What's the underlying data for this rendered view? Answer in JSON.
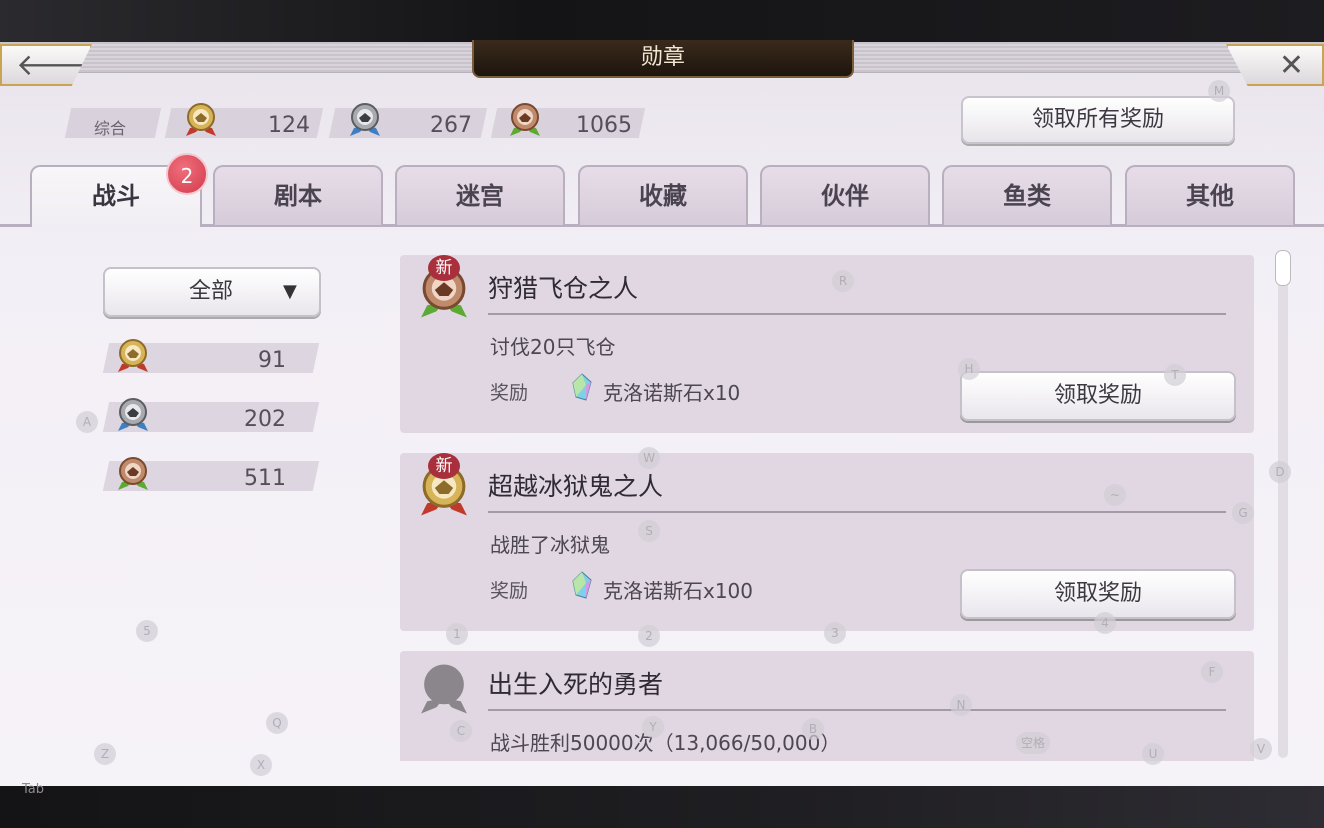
{
  "window": {
    "title": "勋章"
  },
  "nav": {
    "back_icon": "arrow-left-icon",
    "close_icon": "close-icon",
    "back_glyph": "🡐",
    "close_glyph": "✕"
  },
  "stats": {
    "label": "综合",
    "gold": "124",
    "silver": "267",
    "bronze": "1065"
  },
  "claim_all_label": "领取所有奖励",
  "tabs": [
    {
      "label": "战斗",
      "active": true
    },
    {
      "label": "剧本"
    },
    {
      "label": "迷宫"
    },
    {
      "label": "收藏"
    },
    {
      "label": "伙伴"
    },
    {
      "label": "鱼类"
    },
    {
      "label": "其他"
    }
  ],
  "tab_badge": "2",
  "filter": {
    "selected": "全部",
    "caret": "▼"
  },
  "side_counts": {
    "gold": "91",
    "silver": "202",
    "bronze": "511"
  },
  "achievements": [
    {
      "new_tag": "新",
      "title": "狩猎飞仓之人",
      "desc": "讨伐20只飞仓",
      "reward_label": "奖励",
      "reward_item": "克洛诺斯石x10",
      "claim_label": "领取奖励",
      "medal": "bronze"
    },
    {
      "new_tag": "新",
      "title": "超越冰狱鬼之人",
      "desc": "战胜了冰狱鬼",
      "reward_label": "奖励",
      "reward_item": "克洛诺斯石x100",
      "claim_label": "领取奖励",
      "medal": "gold"
    },
    {
      "title": "出生入死的勇者",
      "desc": "战斗胜利50000次（13,066/50,000）",
      "medal": "locked"
    }
  ],
  "overlay_keys": [
    "M",
    "R",
    "H",
    "T",
    "A",
    "W",
    "D",
    "G",
    "S",
    "~",
    "5",
    "1",
    "2",
    "3",
    "4",
    "F",
    "Q",
    "C",
    "Y",
    "B",
    "N",
    "空格",
    "U",
    "Z",
    "X",
    "V"
  ],
  "tab_key_label": "Tab",
  "colors": {
    "gold_medal": "#d8b458",
    "silver_medal": "#a9aab0",
    "bronze_medal": "#c08a6c",
    "red_ribbon": "#c03a2c",
    "blue_ribbon": "#3d7fc4",
    "green_ribbon": "#5caa34",
    "badge_red": "#d9404f",
    "title_plate": "#2a1d12"
  }
}
